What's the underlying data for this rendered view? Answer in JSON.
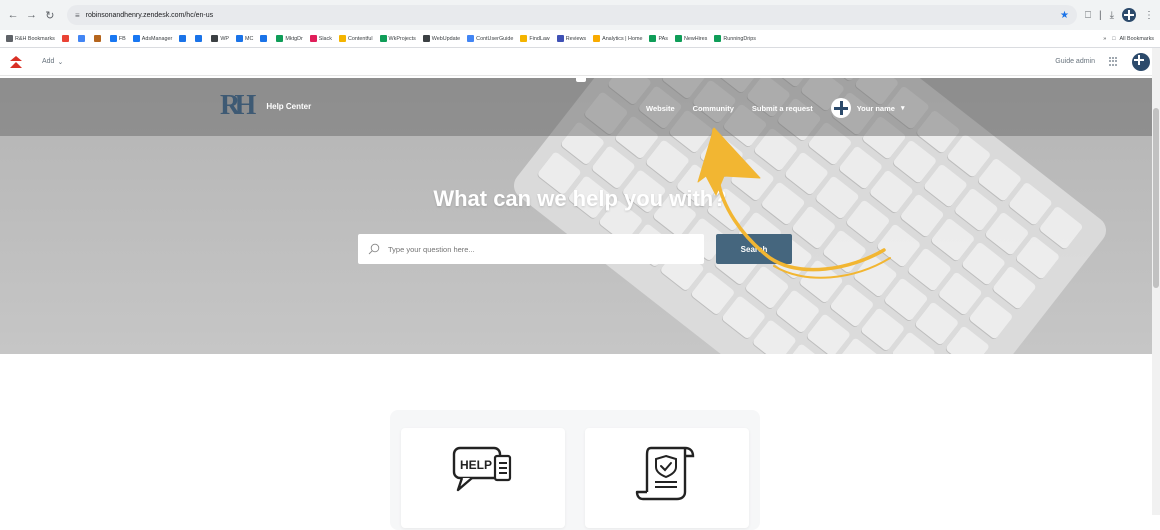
{
  "browser": {
    "url": "robinsonandhenry.zendesk.com/hc/en-us",
    "bookmarks": [
      {
        "label": "R&H Bookmarks",
        "color": "#5f6368"
      },
      {
        "label": "",
        "color": "#ea4335"
      },
      {
        "label": "",
        "color": "#4285f4"
      },
      {
        "label": "",
        "color": "#b5651d"
      },
      {
        "label": "FB",
        "color": "#1877f2"
      },
      {
        "label": "AdsManager",
        "color": "#1877f2"
      },
      {
        "label": "",
        "color": "#1a73e8"
      },
      {
        "label": "",
        "color": "#1a73e8"
      },
      {
        "label": "WP",
        "color": "#3c4043"
      },
      {
        "label": "MC",
        "color": "#1a73e8"
      },
      {
        "label": "",
        "color": "#1a73e8"
      },
      {
        "label": "MktgDr",
        "color": "#0f9d58"
      },
      {
        "label": "Slack",
        "color": "#e01e5a"
      },
      {
        "label": "Contentful",
        "color": "#f4b400"
      },
      {
        "label": "WkProjects",
        "color": "#0f9d58"
      },
      {
        "label": "WebUpdate",
        "color": "#3c4043"
      },
      {
        "label": "ContUserGuide",
        "color": "#4285f4"
      },
      {
        "label": "FindLaw",
        "color": "#f4b400"
      },
      {
        "label": "Reviews",
        "color": "#3f51b5"
      },
      {
        "label": "Analytics | Home",
        "color": "#f9ab00"
      },
      {
        "label": "PAs",
        "color": "#0f9d58"
      },
      {
        "label": "NewHires",
        "color": "#0f9d58"
      },
      {
        "label": "RunningDrips",
        "color": "#0f9d58"
      }
    ],
    "all_bookmarks": "All Bookmarks"
  },
  "admin_bar": {
    "add_label": "Add",
    "guide_admin": "Guide admin"
  },
  "hero": {
    "brand_name": "Help Center",
    "nav": {
      "website": "Website",
      "community": "Community",
      "submit_request": "Submit a request",
      "user_name": "Your name"
    },
    "title": "What can we help you with?",
    "search_placeholder": "Type your question here...",
    "search_button": "Search"
  },
  "cards": [
    {
      "icon": "help-chat-icon",
      "icon_text": "HELP"
    },
    {
      "icon": "policy-document-icon"
    }
  ],
  "colors": {
    "brand": "#3e5a74",
    "search_button": "#45667e",
    "annotation_arrow": "#f2b632"
  }
}
